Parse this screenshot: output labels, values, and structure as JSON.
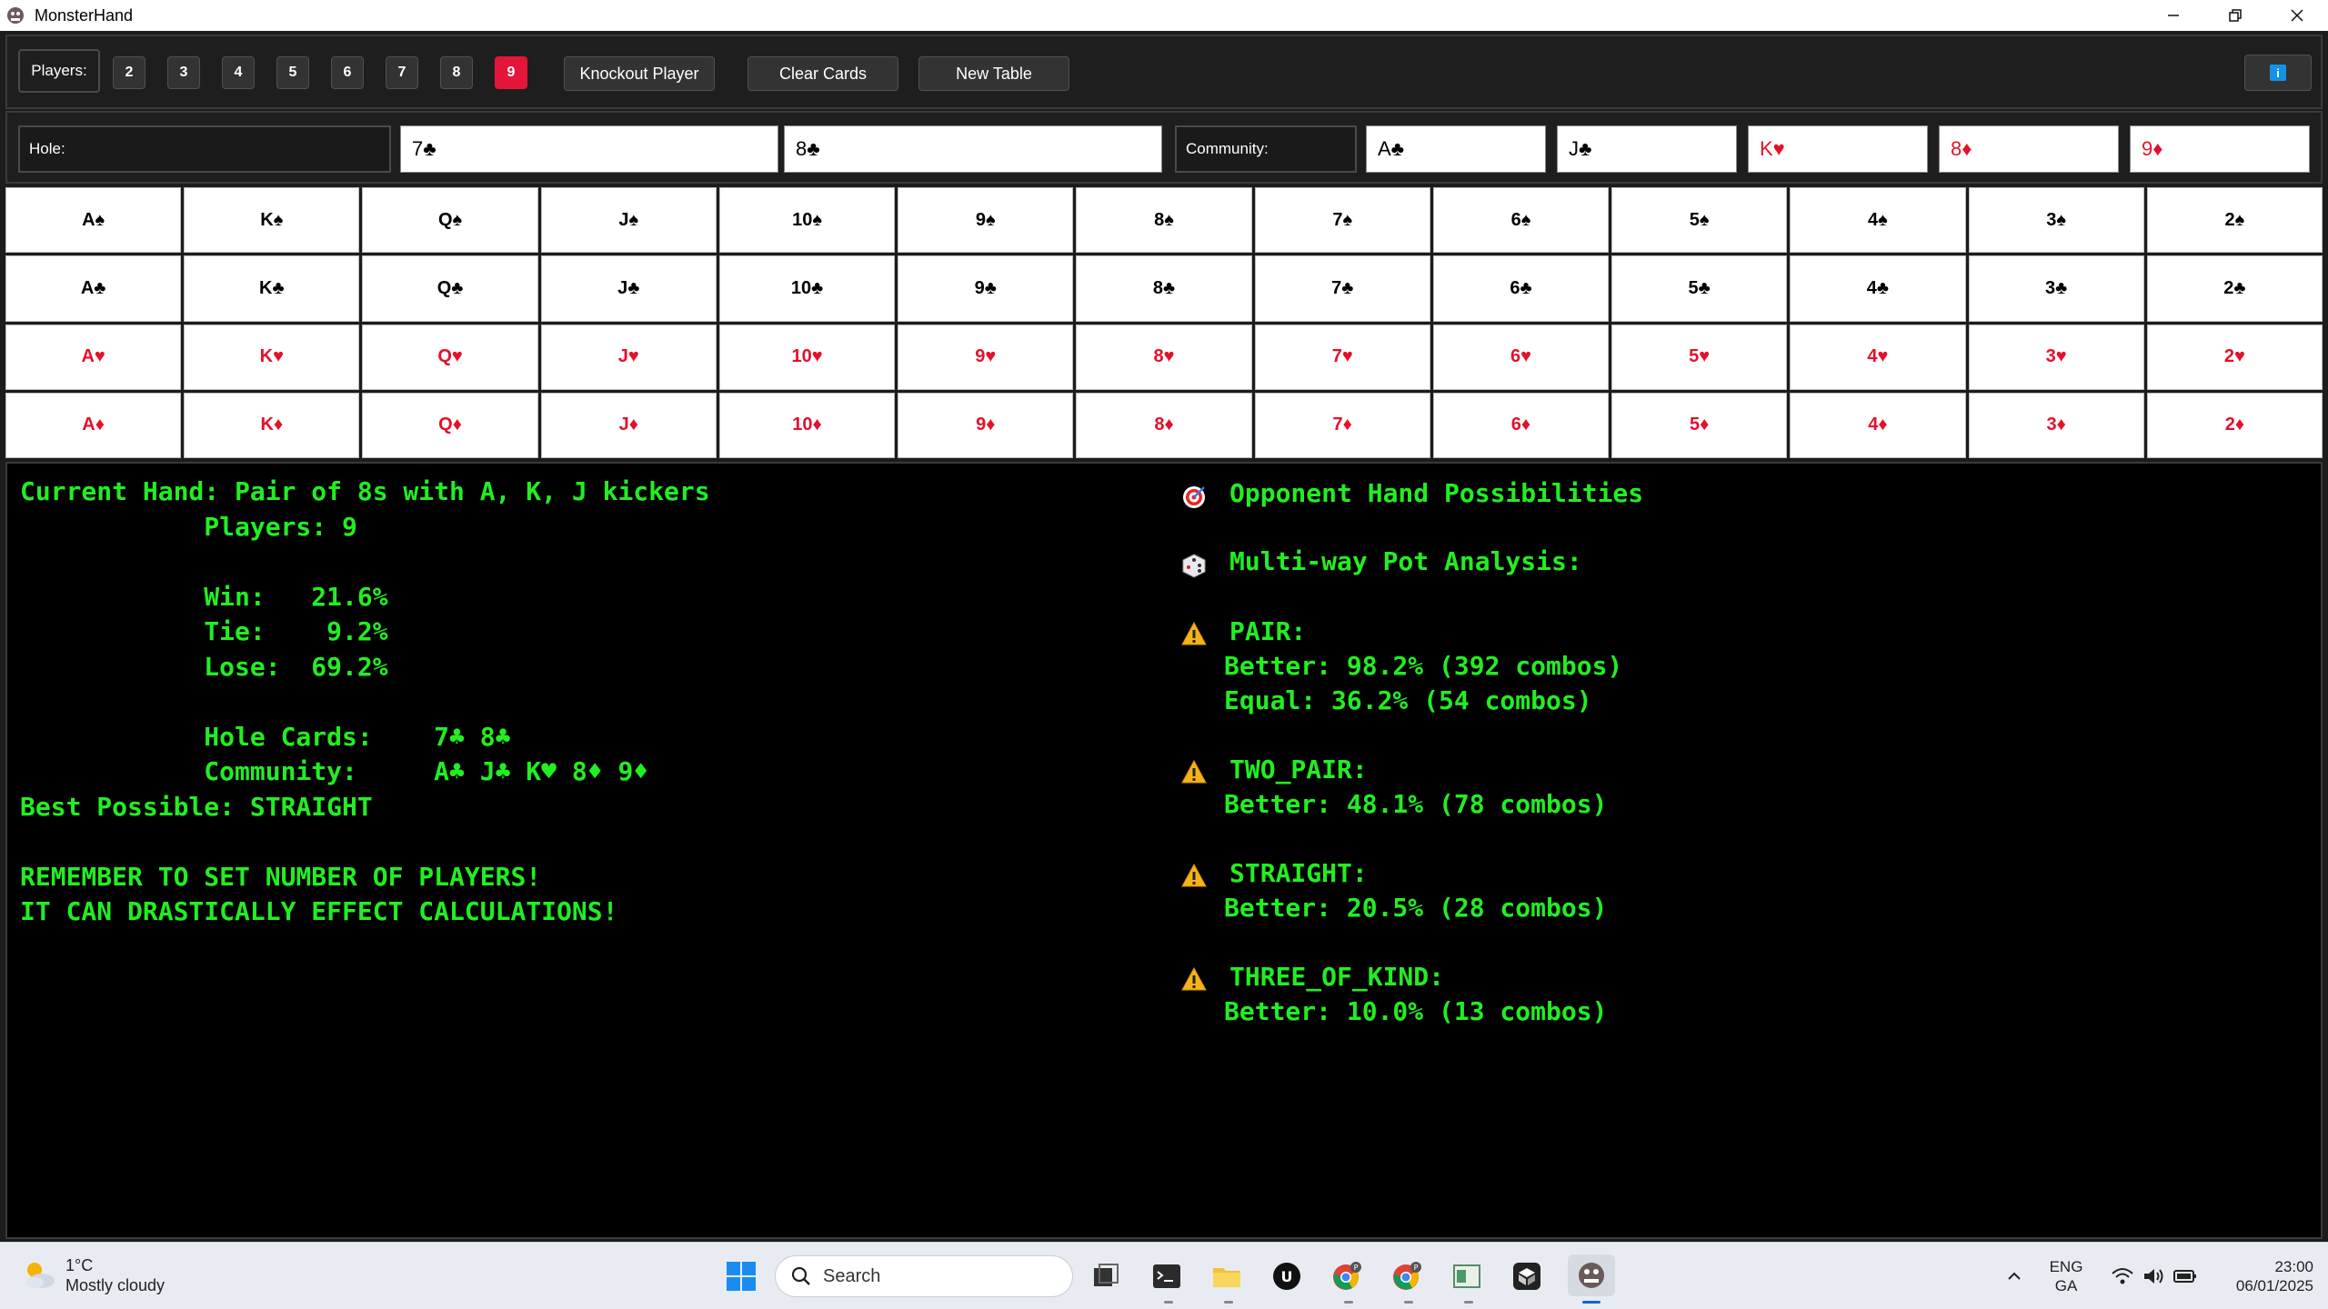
{
  "window": {
    "title": "MonsterHand"
  },
  "toolbar": {
    "players_label": "Players:",
    "player_options": [
      "2",
      "3",
      "4",
      "5",
      "6",
      "7",
      "8",
      "9"
    ],
    "active_players": "9",
    "knockout_label": "Knockout Player",
    "clear_label": "Clear Cards",
    "new_table_label": "New Table"
  },
  "cards_row": {
    "hole_label": "Hole:",
    "hole_cards": [
      "7♣",
      "8♣"
    ],
    "community_label": "Community:",
    "community_cards": [
      "A♣",
      "J♣",
      "K♥",
      "8♦",
      "9♦"
    ]
  },
  "grid": {
    "ranks": [
      "A",
      "K",
      "Q",
      "J",
      "10",
      "9",
      "8",
      "7",
      "6",
      "5",
      "4",
      "3",
      "2"
    ],
    "suits": [
      "♠",
      "♣",
      "♥",
      "♦"
    ]
  },
  "output": {
    "left": [
      "Current Hand: Pair of 8s with A, K, J kickers",
      "            Players: 9",
      "",
      "            Win:   21.6%",
      "            Tie:    9.2%",
      "            Lose:  69.2%",
      "",
      "            Hole Cards:    7♣ 8♣",
      "            Community:     A♣ J♣ K♥ 8♦ 9♦",
      "Best Possible: STRAIGHT",
      "",
      "REMEMBER TO SET NUMBER OF PLAYERS!",
      "IT CAN DRASTICALLY EFFECT CALCULATIONS!"
    ],
    "opp_title": "Opponent Hand Possibilities",
    "multiway_title": "Multi-way Pot Analysis:",
    "groups": [
      {
        "name": "PAIR:",
        "lines": [
          "Better: 98.2% (392 combos)",
          "Equal: 36.2% (54 combos)"
        ]
      },
      {
        "name": "TWO_PAIR:",
        "lines": [
          "Better: 48.1% (78 combos)"
        ]
      },
      {
        "name": "STRAIGHT:",
        "lines": [
          "Better: 20.5% (28 combos)"
        ]
      },
      {
        "name": "THREE_OF_KIND:",
        "lines": [
          "Better: 10.0% (13 combos)"
        ]
      }
    ]
  },
  "taskbar": {
    "weather_temp": "1°C",
    "weather_desc": "Mostly cloudy",
    "search_label": "Search",
    "lang_top": "ENG",
    "lang_bottom": "GA",
    "time": "23:00",
    "date": "06/01/2025"
  },
  "colors": {
    "green": "#22ee22",
    "red": "#e5102a",
    "active": "#e5153a"
  }
}
